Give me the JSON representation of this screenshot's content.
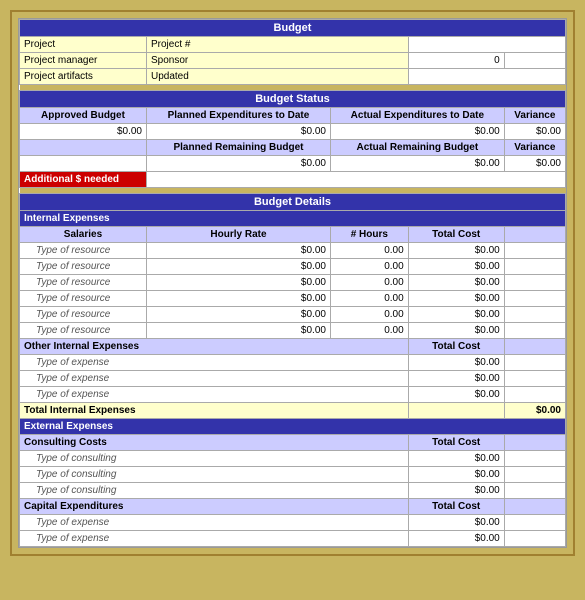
{
  "title": "Budget",
  "header": {
    "project_label": "Project",
    "project_num_label": "Project #",
    "project_manager_label": "Project manager",
    "sponsor_label": "Sponsor",
    "sponsor_value": "0",
    "project_artifacts_label": "Project artifacts",
    "updated_label": "Updated"
  },
  "budget_status": {
    "title": "Budget Status",
    "approved_budget": "Approved Budget",
    "planned_exp": "Planned Expenditures to Date",
    "actual_exp": "Actual Expenditures to Date",
    "variance": "Variance",
    "approved_val": "$0.00",
    "planned_val": "$0.00",
    "actual_val": "$0.00",
    "variance_val": "$0.00",
    "planned_remaining": "Planned Remaining Budget",
    "actual_remaining": "Actual Remaining Budget",
    "variance2": "Variance",
    "planned_rem_val": "$0.00",
    "actual_rem_val": "$0.00",
    "variance2_val": "$0.00",
    "additional": "Additional $ needed"
  },
  "budget_details": {
    "title": "Budget Details",
    "internal_expenses": "Internal Expenses",
    "salaries": "Salaries",
    "hourly_rate": "Hourly Rate",
    "num_hours": "# Hours",
    "total_cost": "Total Cost",
    "resources": [
      {
        "name": "Type of resource",
        "rate": "$0.00",
        "hours": "0.00",
        "cost": "$0.00"
      },
      {
        "name": "Type of resource",
        "rate": "$0.00",
        "hours": "0.00",
        "cost": "$0.00"
      },
      {
        "name": "Type of resource",
        "rate": "$0.00",
        "hours": "0.00",
        "cost": "$0.00"
      },
      {
        "name": "Type of resource",
        "rate": "$0.00",
        "hours": "0.00",
        "cost": "$0.00"
      },
      {
        "name": "Type of resource",
        "rate": "$0.00",
        "hours": "0.00",
        "cost": "$0.00"
      },
      {
        "name": "Type of resource",
        "rate": "$0.00",
        "hours": "0.00",
        "cost": "$0.00"
      }
    ],
    "other_internal": "Other Internal Expenses",
    "other_internal_total": "Total Cost",
    "other_expenses": [
      {
        "name": "Type of expense",
        "cost": "$0.00"
      },
      {
        "name": "Type of expense",
        "cost": "$0.00"
      },
      {
        "name": "Type of expense",
        "cost": "$0.00"
      }
    ],
    "total_internal": "Total Internal Expenses",
    "total_internal_val": "$0.00",
    "external_expenses": "External Expenses",
    "consulting_costs": "Consulting Costs",
    "consulting_total": "Total Cost",
    "consulting": [
      {
        "name": "Type of consulting",
        "cost": "$0.00"
      },
      {
        "name": "Type of consulting",
        "cost": "$0.00"
      },
      {
        "name": "Type of consulting",
        "cost": "$0.00"
      }
    ],
    "capital_exp": "Capital Expenditures",
    "capital_total": "Total Cost",
    "capital": [
      {
        "name": "Type of expense",
        "cost": "$0.00"
      },
      {
        "name": "Type of expense",
        "cost": "$0.00"
      }
    ]
  }
}
